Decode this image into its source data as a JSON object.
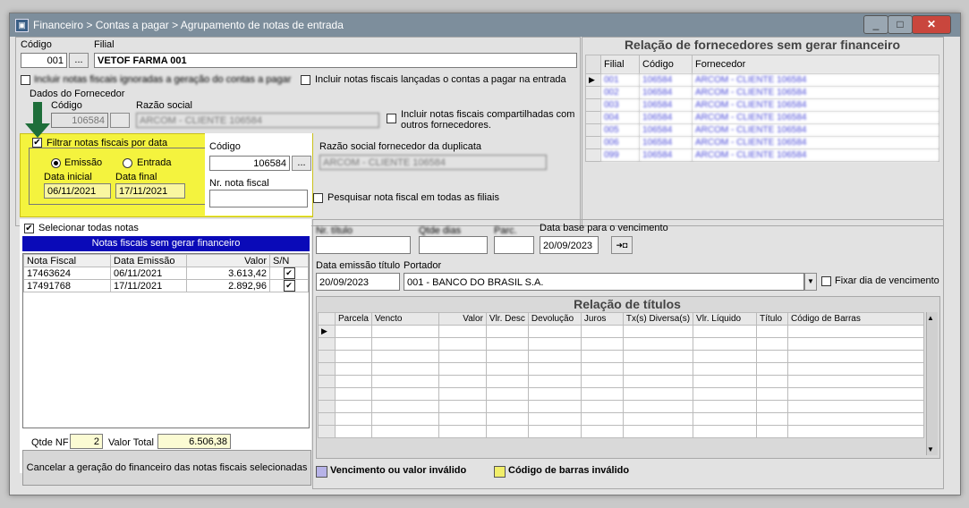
{
  "window": {
    "title": "Financeiro > Contas a pagar > Agrupamento de notas de entrada",
    "min": "_",
    "max": "□",
    "close": "✕"
  },
  "codigo": {
    "label": "Código",
    "value": "001",
    "btn": "..."
  },
  "filial": {
    "label": "Filial",
    "value": "VETOF FARMA 001"
  },
  "chk_ignoradas": "Incluir notas fiscais ignoradas a geração do contas a pagar",
  "chk_lancadas": "Incluir notas fiscais lançadas o contas a pagar na entrada",
  "fornecedor": {
    "group": "Dados do Fornecedor",
    "codigo_label": "Código",
    "codigo_value": "106584",
    "razao_label": "Razão social",
    "razao_value": "ARCOM - CLIENTE 106584",
    "compartilhadas": "Incluir notas fiscais compartilhadas com outros fornecedores."
  },
  "filtro": {
    "label": "Filtrar notas fiscais por data",
    "emissao": "Emissão",
    "entrada": "Entrada",
    "data_inicial_label": "Data inicial",
    "data_inicial": "06/11/2021",
    "data_final_label": "Data final",
    "data_final": "17/11/2021"
  },
  "dup": {
    "codigo_label": "Código",
    "codigo_value": "106584",
    "btn": "...",
    "nr_nota_label": "Nr. nota fiscal",
    "nr_nota_value": "",
    "razao_label": "Razão social fornecedor da duplicata",
    "razao_value": "ARCOM - CLIENTE 106584",
    "pesquisar": "Pesquisar nota fiscal em todas as filiais"
  },
  "fornecedores_panel": {
    "title": "Relação de fornecedores sem gerar financeiro",
    "headers": [
      "Filial",
      "Código",
      "Fornecedor"
    ],
    "rows": [
      [
        "001",
        "106584",
        "ARCOM - CLIENTE 106584"
      ],
      [
        "002",
        "106584",
        "ARCOM - CLIENTE 106584"
      ],
      [
        "003",
        "106584",
        "ARCOM - CLIENTE 106584"
      ],
      [
        "004",
        "106584",
        "ARCOM - CLIENTE 106584"
      ],
      [
        "005",
        "106584",
        "ARCOM - CLIENTE 106584"
      ],
      [
        "006",
        "106584",
        "ARCOM - CLIENTE 106584"
      ],
      [
        "099",
        "106584",
        "ARCOM - CLIENTE 106584"
      ]
    ]
  },
  "notas": {
    "selecionar": "Selecionar todas notas",
    "title": "Notas fiscais sem gerar financeiro",
    "headers": [
      "Nota Fiscal",
      "Data Emissão",
      "Valor",
      "S/N"
    ],
    "rows": [
      {
        "nf": "17463624",
        "data": "06/11/2021",
        "valor": "3.613,42",
        "sn": "✔"
      },
      {
        "nf": "17491768",
        "data": "17/11/2021",
        "valor": "2.892,96",
        "sn": "✔"
      }
    ],
    "qtde_label": "Qtde NF",
    "qtde": "2",
    "total_label": "Valor Total",
    "total": "6.506,38",
    "cancelar": "Cancelar a geração do financeiro das notas fiscais selecionadas"
  },
  "titulos": {
    "nr_titulo_label": "Nr. título",
    "qtde_dias_label": "Qtde dias",
    "parc_label": "Parc.",
    "data_base_label": "Data base para o vencimento",
    "data_base": "20/09/2023",
    "data_btn": "➜◘",
    "emissao_label": "Data emissão título",
    "emissao": "20/09/2023",
    "portador_label": "Portador",
    "portador": "001 - BANCO DO BRASIL S.A.",
    "fixar": "Fixar dia de vencimento",
    "panel_title": "Relação de títulos",
    "headers": [
      "Parcela",
      "Vencto",
      "Valor",
      "Vlr. Desc",
      "Devolução",
      "Juros",
      "Tx(s) Diversa(s)",
      "Vlr. Líquido",
      "Título",
      "Código de Barras"
    ]
  },
  "legend": {
    "invalido": "Vencimento ou valor inválido",
    "barras": "Código de barras inválido",
    "color_invalido": "#b7b3e8",
    "color_barras": "#f1ee6a"
  }
}
